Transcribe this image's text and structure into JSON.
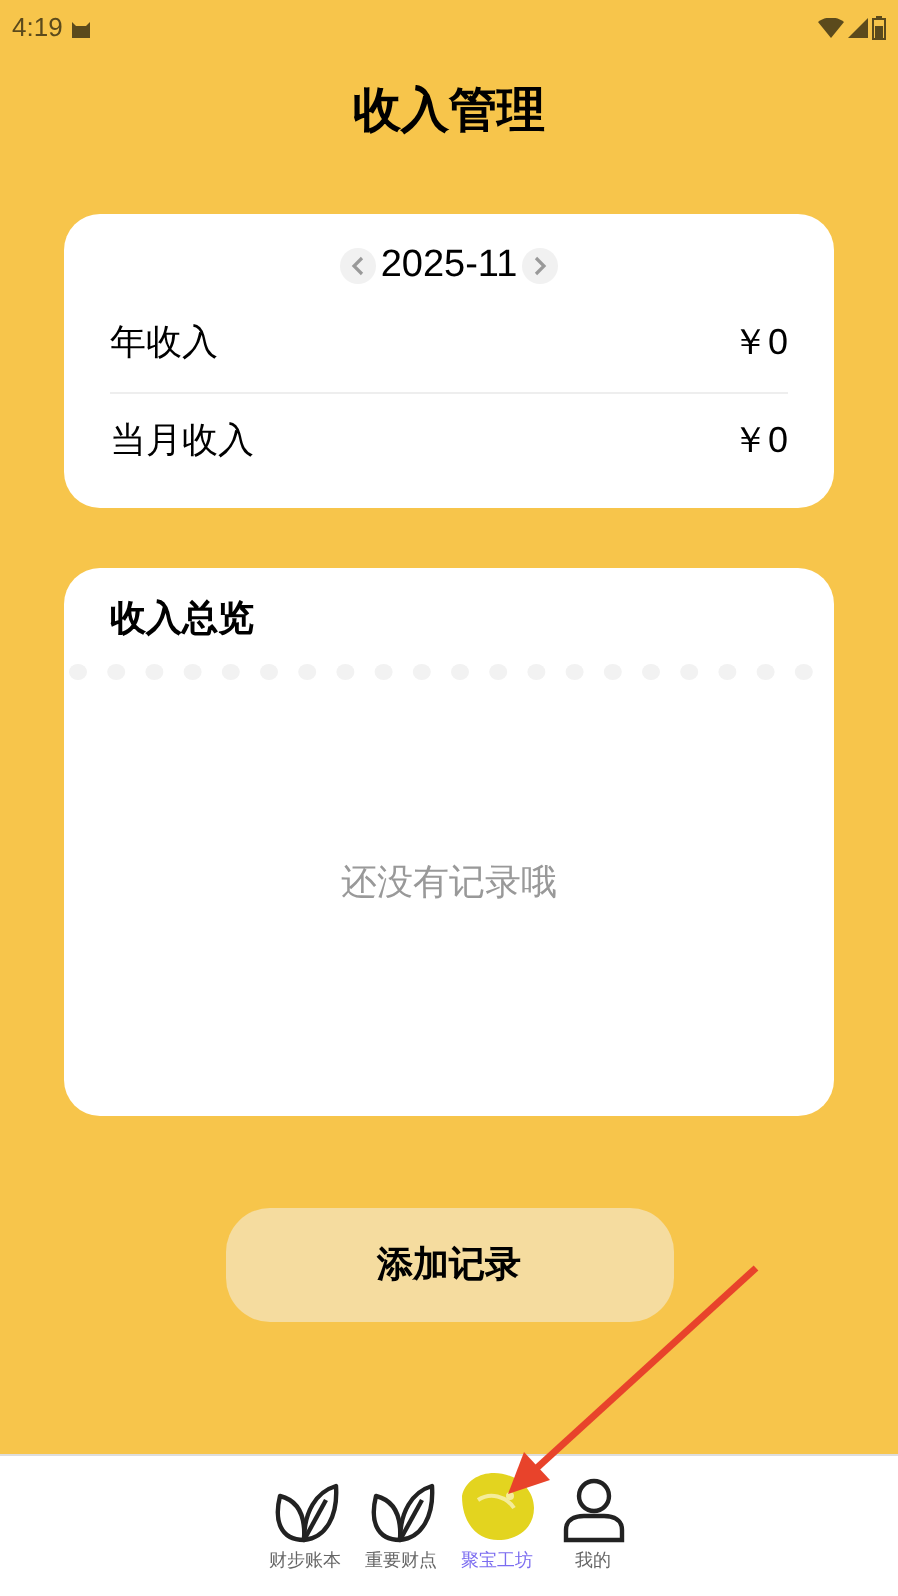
{
  "status_bar": {
    "time": "4:19"
  },
  "title": "收入管理",
  "summary": {
    "month": "2025-11",
    "rows": [
      {
        "label": "年收入",
        "value": "￥0"
      },
      {
        "label": "当月收入",
        "value": "￥0"
      }
    ]
  },
  "overview": {
    "title": "收入总览",
    "empty_text": "还没有记录哦"
  },
  "add_button": "添加记录",
  "nav": [
    {
      "label": "财步账本",
      "kind": "leaf",
      "selected": false
    },
    {
      "label": "重要财点",
      "kind": "leaf",
      "selected": false
    },
    {
      "label": "聚宝工坊",
      "kind": "bird",
      "selected": true
    },
    {
      "label": "我的",
      "kind": "person",
      "selected": false
    }
  ]
}
